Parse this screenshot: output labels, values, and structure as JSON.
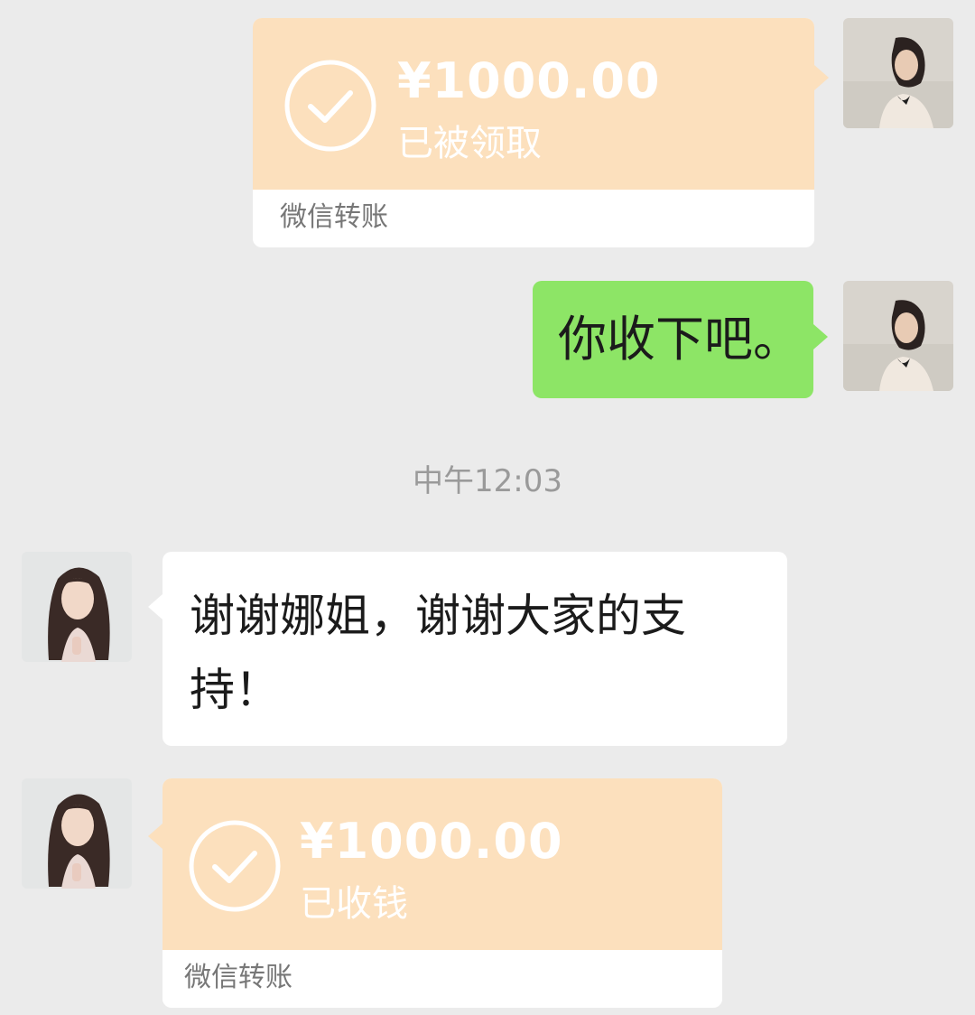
{
  "messages": [
    {
      "side": "right",
      "type": "transfer",
      "amount": "¥1000.00",
      "status": "已被领取",
      "footer": "微信转账"
    },
    {
      "side": "right",
      "type": "text",
      "text": "你收下吧。"
    },
    {
      "type": "timestamp",
      "text": "中午12:03"
    },
    {
      "side": "left",
      "type": "text",
      "text": "谢谢娜姐，谢谢大家的支持！"
    },
    {
      "side": "left",
      "type": "transfer",
      "amount": "¥1000.00",
      "status": "已收钱",
      "footer": "微信转账"
    }
  ],
  "colors": {
    "background": "#ebebeb",
    "transfer_card": "#fce0bd",
    "sent_bubble": "#8de566",
    "received_bubble": "#ffffff",
    "timestamp_text": "#9a9a9a"
  },
  "icons": {
    "transfer_status": "check-circle-icon"
  }
}
